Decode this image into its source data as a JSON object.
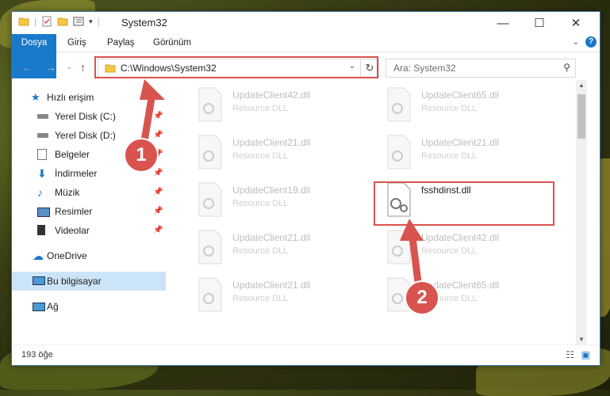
{
  "window": {
    "title": "System32"
  },
  "ribbon": {
    "tabs": [
      {
        "label": "Dosya"
      },
      {
        "label": "Giriş"
      },
      {
        "label": "Paylaş"
      },
      {
        "label": "Görünüm"
      }
    ]
  },
  "address": {
    "path": "C:\\Windows\\System32",
    "search_placeholder": "Ara: System32"
  },
  "sidebar": {
    "items": [
      {
        "label": "Hızlı erişim"
      },
      {
        "label": "Yerel Disk (C:)"
      },
      {
        "label": "Yerel Disk (D:)"
      },
      {
        "label": "Belgeler"
      },
      {
        "label": "İndirmeler"
      },
      {
        "label": "Müzik"
      },
      {
        "label": "Resimler"
      },
      {
        "label": "Videolar"
      },
      {
        "label": "OneDrive"
      },
      {
        "label": "Bu bilgisayar"
      },
      {
        "label": "Ağ"
      }
    ]
  },
  "files": [
    {
      "name": "UpdateClient42.dll",
      "desc": "Resource DLL"
    },
    {
      "name": "UpdateClient65.dll",
      "desc": "Resource DLL"
    },
    {
      "name": "UpdateClient21.dll",
      "desc": "Resource DLL"
    },
    {
      "name": "UpdateClient21.dll",
      "desc": "Resource DLL"
    },
    {
      "name": "UpdateClient19.dll",
      "desc": "Resource DLL"
    },
    {
      "name": "fsshdinst.dll",
      "desc": ""
    },
    {
      "name": "UpdateClient21.dll",
      "desc": "Resource DLL"
    },
    {
      "name": "UpdateClient42.dll",
      "desc": "Resource DLL"
    },
    {
      "name": "UpdateClient21.dll",
      "desc": "Resource DLL"
    },
    {
      "name": "UpdateClient65.dll",
      "desc": "Resource DLL"
    }
  ],
  "status": {
    "count": "193 öğe"
  },
  "annotations": {
    "badge1": "1",
    "badge2": "2"
  },
  "colors": {
    "highlight": "#d9534f",
    "accent": "#1979ca"
  }
}
